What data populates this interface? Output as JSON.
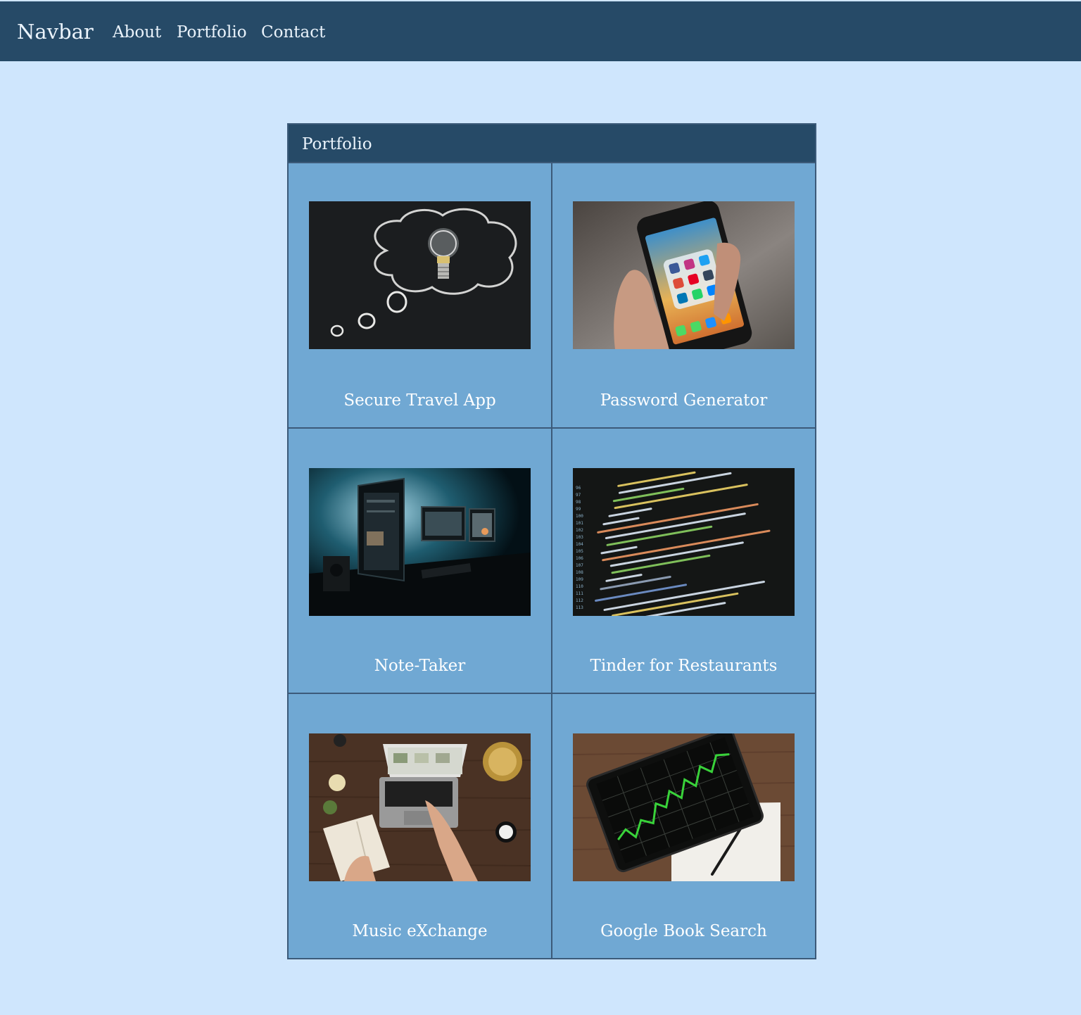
{
  "navbar": {
    "brand": "Navbar",
    "links": [
      {
        "label": "About"
      },
      {
        "label": "Portfolio"
      },
      {
        "label": "Contact"
      }
    ]
  },
  "portfolio": {
    "title": "Portfolio",
    "projects": [
      {
        "title": "Secure Travel App",
        "image": "lightbulb-chalkboard-photo"
      },
      {
        "title": "Password Generator",
        "image": "phone-social-apps-photo"
      },
      {
        "title": "Note-Taker",
        "image": "desk-monitors-photo"
      },
      {
        "title": "Tinder for Restaurants",
        "image": "code-screen-photo"
      },
      {
        "title": "Music eXchange",
        "image": "laptop-desk-photo"
      },
      {
        "title": "Google Book Search",
        "image": "tablet-chart-photo"
      }
    ]
  },
  "colors": {
    "page_background": "#cfe6fd",
    "navbar_background": "#264a67",
    "card_background": "#70a8d3",
    "border": "#3c5a79",
    "text_light": "#eaf3fb"
  }
}
